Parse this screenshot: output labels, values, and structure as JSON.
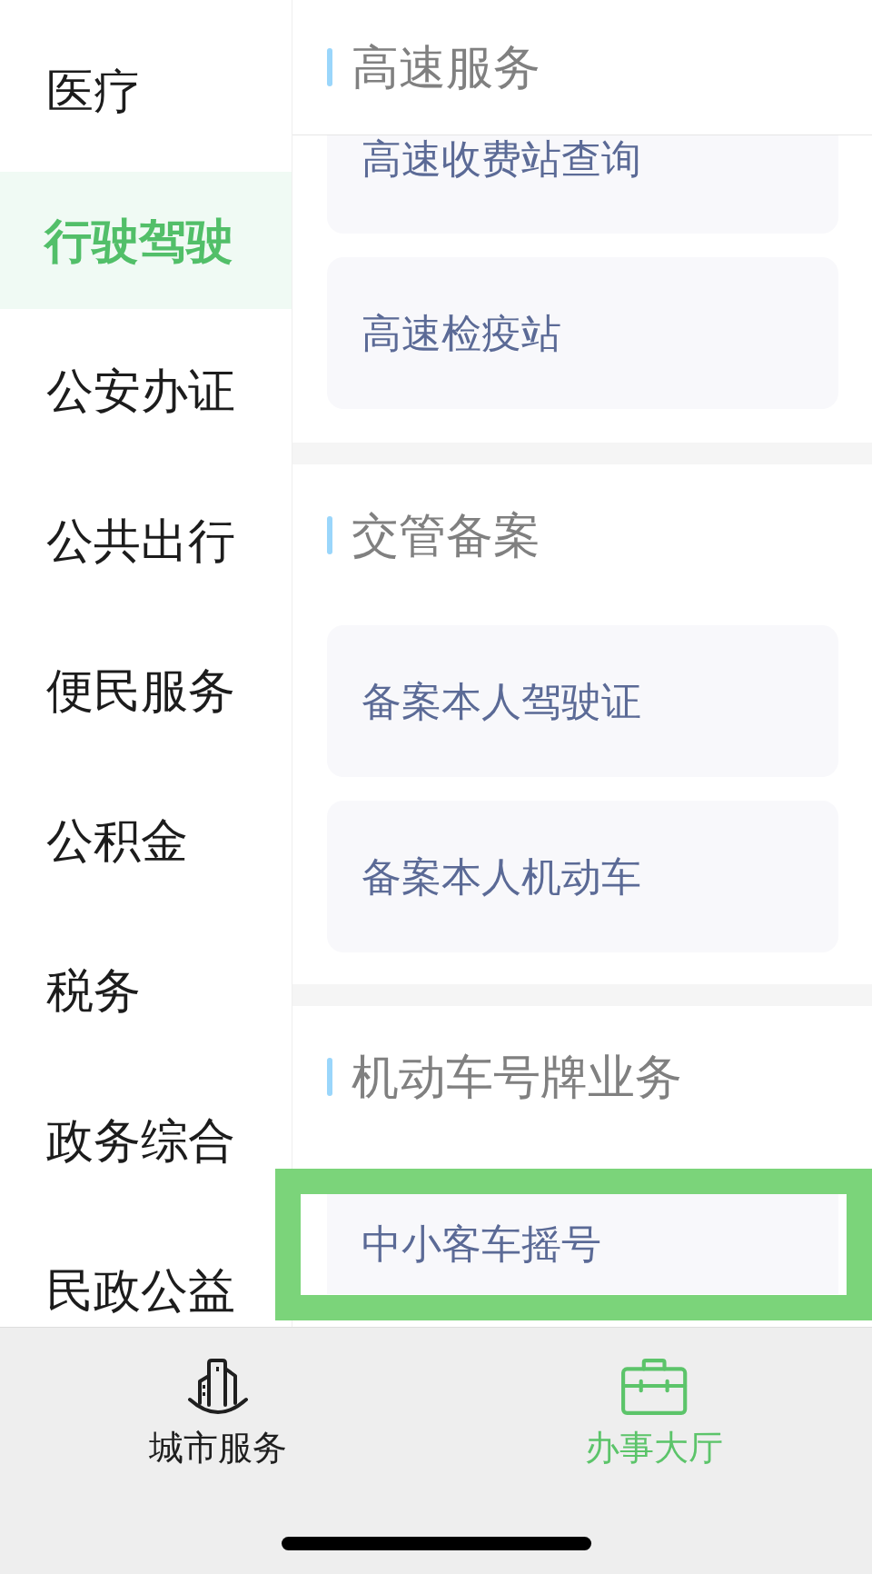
{
  "sidebar": {
    "items": [
      {
        "label": "医疗",
        "selected": false
      },
      {
        "label": "行驶驾驶",
        "selected": true
      },
      {
        "label": "公安办证",
        "selected": false
      },
      {
        "label": "公共出行",
        "selected": false
      },
      {
        "label": "便民服务",
        "selected": false
      },
      {
        "label": "公积金",
        "selected": false
      },
      {
        "label": "税务",
        "selected": false
      },
      {
        "label": "政务综合",
        "selected": false
      },
      {
        "label": "民政公益",
        "selected": false
      }
    ]
  },
  "sections": [
    {
      "title": "高速服务",
      "items": [
        {
          "label": "高速收费站查询",
          "highlighted": false
        },
        {
          "label": "高速检疫站",
          "highlighted": false
        }
      ]
    },
    {
      "title": "交管备案",
      "items": [
        {
          "label": "备案本人驾驶证",
          "highlighted": false
        },
        {
          "label": "备案本人机动车",
          "highlighted": false
        }
      ]
    },
    {
      "title": "机动车号牌业务",
      "items": [
        {
          "label": "中小客车摇号",
          "highlighted": true
        }
      ]
    }
  ],
  "tab_bar": [
    {
      "label": "城市服务",
      "selected": false
    },
    {
      "label": "办事大厅",
      "selected": true
    }
  ]
}
